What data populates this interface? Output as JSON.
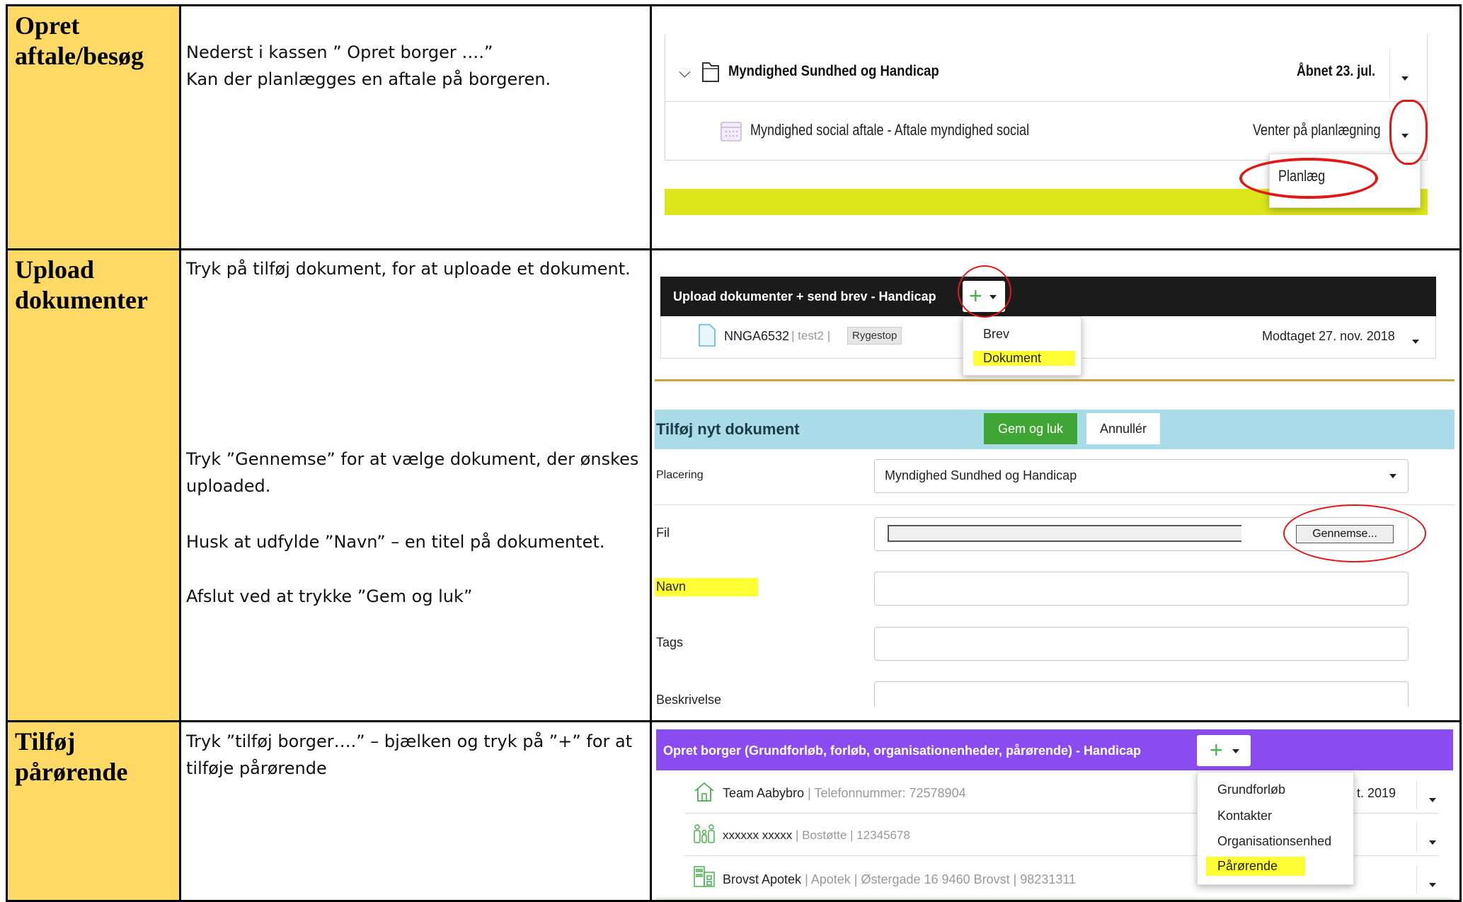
{
  "rows": [
    {
      "title_line1": "Opret",
      "title_line2": "aftale/besøg",
      "desc_line1": "Nederst i kassen ” Opret borger ….”",
      "desc_line2": "Kan der planlægges en aftale på borgeren."
    },
    {
      "title_line1": "Upload",
      "title_line2": "dokumenter",
      "desc1": "Tryk på tilføj dokument, for at uploade et dokument.",
      "desc2_line1": "Tryk ”Gennemse” for at vælge dokument, der ønskes",
      "desc2_line2": "uploaded.",
      "desc3": "Husk at udfylde ”Navn” – en titel på dokumentet.",
      "desc4": "Afslut ved at trykke ”Gem og luk”"
    },
    {
      "title_line1": "Tilføj",
      "title_line2": "pårørende",
      "desc_line1": "Tryk ”tilføj borger….” – bjælken og tryk på ”+” for at",
      "desc_line2": "tilføje pårørende"
    }
  ],
  "shot1": {
    "group_title": "Myndighed Sundhed og Handicap",
    "group_status": "Åbnet 23. jul.",
    "item_title": "Myndighed social aftale - Aftale myndighed social",
    "item_status": "Venter på planlægning",
    "menu_item": "Planlæg"
  },
  "shot2": {
    "header_title": "Upload dokumenter + send brev - Handicap",
    "doc_name": "NNGA6532",
    "doc_sub": "| test2 |",
    "doc_tag": "Rygestop",
    "doc_received": "Modtaget 27. nov. 2018",
    "menu": [
      "Brev",
      "Dokument"
    ],
    "form_title": "Tilføj nyt dokument",
    "save_label": "Gem og luk",
    "cancel_label": "Annullér",
    "placering_label": "Placering",
    "placering_value": "Myndighed Sundhed og Handicap",
    "fil_label": "Fil",
    "browse_label": "Gennemse...",
    "navn_label": "Navn",
    "tags_label": "Tags",
    "beskrivelse_label": "Beskrivelse"
  },
  "shot3": {
    "header_title": "Opret borger (Grundforløb, forløb, organisationenheder, pårørende) - Handicap",
    "items": [
      {
        "name": "Team Aabybro",
        "meta": "| Telefonnummer: 72578904"
      },
      {
        "name": "xxxxxx xxxxx",
        "meta": "| Bostøtte | 12345678"
      },
      {
        "name": "Brovst Apotek",
        "meta": "| Apotek | Østergade 16 9460 Brovst | 98231311"
      }
    ],
    "row1_date": "t. 2019",
    "menu": [
      "Grundforløb",
      "Kontakter",
      "Organisationsenhed",
      "Pårørende"
    ]
  },
  "colors": {
    "title_bg": "#ffd966",
    "highlight": "#ffff33",
    "annotation": "#e01818",
    "form_header": "#a9dbe8",
    "save_green": "#3fa535",
    "purple_header": "#8a4cf0",
    "lime_band": "#dde61a"
  }
}
